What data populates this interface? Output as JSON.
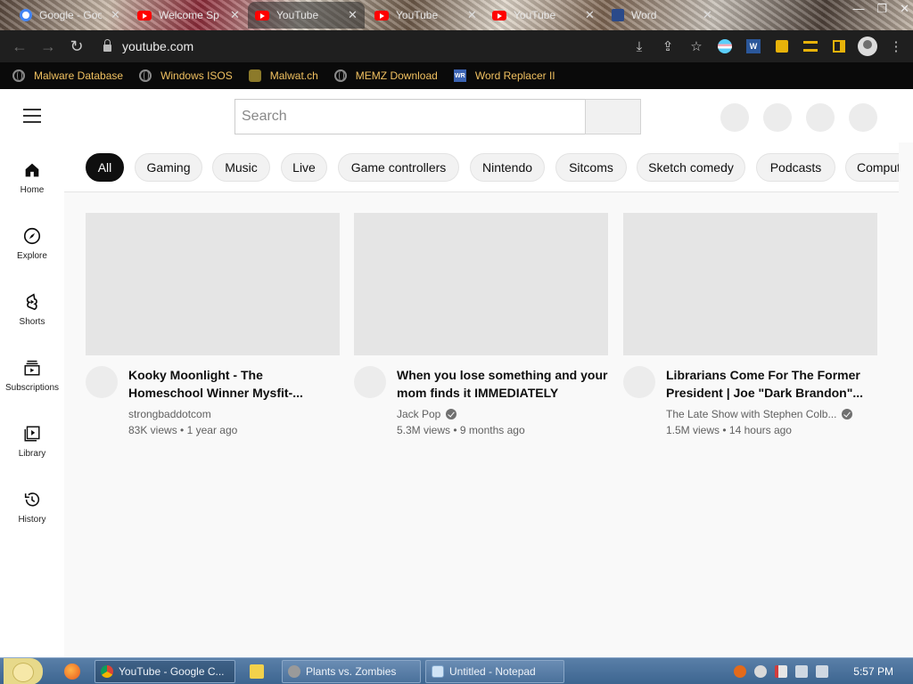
{
  "browser": {
    "tabs": [
      {
        "title": "Google - Google",
        "icon": "google-icon"
      },
      {
        "title": "Welcome Sp",
        "icon": "youtube-icon"
      },
      {
        "title": "YouTube",
        "icon": "youtube-icon"
      },
      {
        "title": "YouTube",
        "icon": "youtube-icon"
      },
      {
        "title": "YouTube",
        "icon": "youtube-icon"
      },
      {
        "title": "Word",
        "icon": "word-replacer-icon"
      }
    ],
    "address": "youtube.com",
    "bookmarks": [
      {
        "label": "Malware Database",
        "icon": "globe-icon"
      },
      {
        "label": "Windows ISOS",
        "icon": "globe-icon"
      },
      {
        "label": "Malwat.ch",
        "icon": "hazard-icon"
      },
      {
        "label": "MEMZ Download",
        "icon": "globe-icon"
      },
      {
        "label": "Word Replacer II",
        "icon": "word-replacer-icon"
      }
    ]
  },
  "youtube": {
    "search_placeholder": "Search",
    "sidebar": [
      {
        "label": "Home",
        "icon": "home-icon"
      },
      {
        "label": "Explore",
        "icon": "compass-icon"
      },
      {
        "label": "Shorts",
        "icon": "shorts-icon"
      },
      {
        "label": "Subscriptions",
        "icon": "subscriptions-icon"
      },
      {
        "label": "Library",
        "icon": "library-icon"
      },
      {
        "label": "History",
        "icon": "history-icon"
      }
    ],
    "chips": [
      "All",
      "Gaming",
      "Music",
      "Live",
      "Game controllers",
      "Nintendo",
      "Sitcoms",
      "Sketch comedy",
      "Podcasts",
      "Computers"
    ],
    "active_chip": "All",
    "videos": [
      {
        "title": "Kooky Moonlight - The Homeschool Winner Mysfit-...",
        "channel": "strongbaddotcom",
        "verified": false,
        "views": "83K views",
        "age": "1 year ago"
      },
      {
        "title": "When you lose something and your mom finds it IMMEDIATELY",
        "channel": "Jack Pop",
        "verified": true,
        "views": "5.3M views",
        "age": "9 months ago"
      },
      {
        "title": "Librarians Come For The Former President | Joe \"Dark Brandon\"...",
        "channel": "The Late Show with Stephen Colb...",
        "verified": true,
        "views": "1.5M views",
        "age": "14 hours ago"
      }
    ],
    "separator": "•"
  },
  "taskbar": {
    "tasks": [
      {
        "label": "YouTube - Google C...",
        "icon": "chrome-icon",
        "active": true
      },
      {
        "label": "Plants vs. Zombies",
        "icon": "pvz-icon",
        "active": false
      },
      {
        "label": "Untitled - Notepad",
        "icon": "notepad-icon",
        "active": false
      }
    ],
    "clock": "5:57 PM"
  },
  "colors": {
    "accent": "#0f0f0f",
    "bookmark_text": "#f0c060",
    "youtube_red": "#ff0000"
  }
}
